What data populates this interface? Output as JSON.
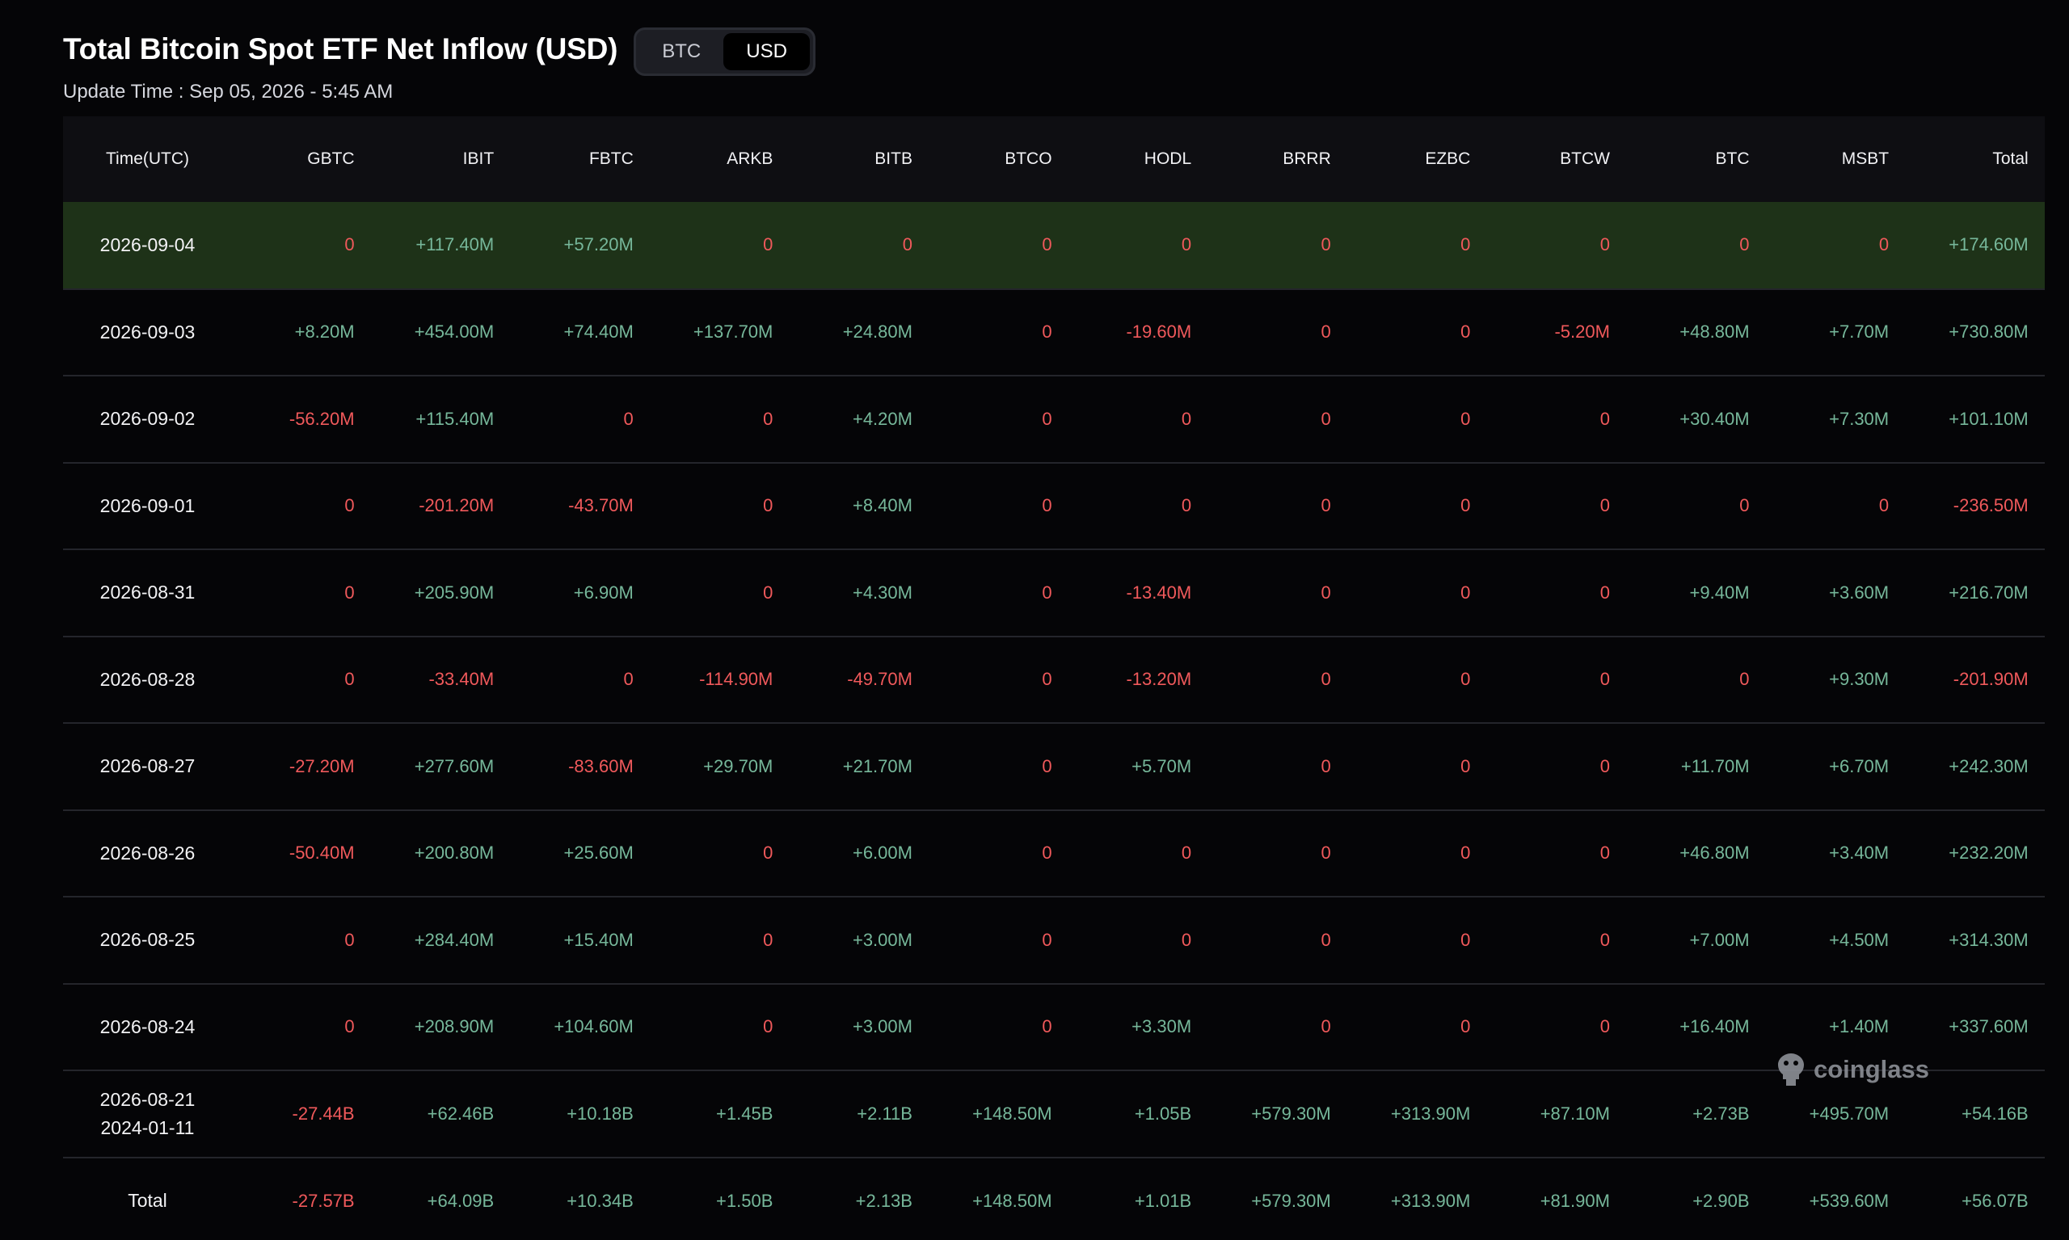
{
  "title": "Total Bitcoin Spot ETF Net Inflow (USD)",
  "toggle": {
    "btc_label": "BTC",
    "usd_label": "USD",
    "selected": "USD"
  },
  "update_time": "Update Time : Sep 05, 2026 - 5:45 AM",
  "watermark": "coinglass",
  "colors": {
    "positive": "#76b79a",
    "negative": "#f0595b",
    "highlight_row": "#1e3218"
  },
  "columns": [
    "Time(UTC)",
    "GBTC",
    "IBIT",
    "FBTC",
    "ARKB",
    "BITB",
    "BTCO",
    "HODL",
    "BRRR",
    "EZBC",
    "BTCW",
    "BTC",
    "MSBT",
    "Total"
  ],
  "rows": [
    {
      "time": [
        "2026-09-04"
      ],
      "highlight": true,
      "values": [
        "0",
        "+117.40M",
        "+57.20M",
        "0",
        "0",
        "0",
        "0",
        "0",
        "0",
        "0",
        "0",
        "0",
        "+174.60M"
      ]
    },
    {
      "time": [
        "2026-09-03"
      ],
      "values": [
        "+8.20M",
        "+454.00M",
        "+74.40M",
        "+137.70M",
        "+24.80M",
        "0",
        "-19.60M",
        "0",
        "0",
        "-5.20M",
        "+48.80M",
        "+7.70M",
        "+730.80M"
      ]
    },
    {
      "time": [
        "2026-09-02"
      ],
      "values": [
        "-56.20M",
        "+115.40M",
        "0",
        "0",
        "+4.20M",
        "0",
        "0",
        "0",
        "0",
        "0",
        "+30.40M",
        "+7.30M",
        "+101.10M"
      ]
    },
    {
      "time": [
        "2026-09-01"
      ],
      "values": [
        "0",
        "-201.20M",
        "-43.70M",
        "0",
        "+8.40M",
        "0",
        "0",
        "0",
        "0",
        "0",
        "0",
        "0",
        "-236.50M"
      ]
    },
    {
      "time": [
        "2026-08-31"
      ],
      "values": [
        "0",
        "+205.90M",
        "+6.90M",
        "0",
        "+4.30M",
        "0",
        "-13.40M",
        "0",
        "0",
        "0",
        "+9.40M",
        "+3.60M",
        "+216.70M"
      ]
    },
    {
      "time": [
        "2026-08-28"
      ],
      "values": [
        "0",
        "-33.40M",
        "0",
        "-114.90M",
        "-49.70M",
        "0",
        "-13.20M",
        "0",
        "0",
        "0",
        "0",
        "+9.30M",
        "-201.90M"
      ]
    },
    {
      "time": [
        "2026-08-27"
      ],
      "values": [
        "-27.20M",
        "+277.60M",
        "-83.60M",
        "+29.70M",
        "+21.70M",
        "0",
        "+5.70M",
        "0",
        "0",
        "0",
        "+11.70M",
        "+6.70M",
        "+242.30M"
      ]
    },
    {
      "time": [
        "2026-08-26"
      ],
      "values": [
        "-50.40M",
        "+200.80M",
        "+25.60M",
        "0",
        "+6.00M",
        "0",
        "0",
        "0",
        "0",
        "0",
        "+46.80M",
        "+3.40M",
        "+232.20M"
      ]
    },
    {
      "time": [
        "2026-08-25"
      ],
      "values": [
        "0",
        "+284.40M",
        "+15.40M",
        "0",
        "+3.00M",
        "0",
        "0",
        "0",
        "0",
        "0",
        "+7.00M",
        "+4.50M",
        "+314.30M"
      ]
    },
    {
      "time": [
        "2026-08-24"
      ],
      "values": [
        "0",
        "+208.90M",
        "+104.60M",
        "0",
        "+3.00M",
        "0",
        "+3.30M",
        "0",
        "0",
        "0",
        "+16.40M",
        "+1.40M",
        "+337.60M"
      ]
    },
    {
      "time": [
        "2026-08-21",
        "2024-01-11"
      ],
      "values": [
        "-27.44B",
        "+62.46B",
        "+10.18B",
        "+1.45B",
        "+2.11B",
        "+148.50M",
        "+1.05B",
        "+579.30M",
        "+313.90M",
        "+87.10M",
        "+2.73B",
        "+495.70M",
        "+54.16B"
      ]
    },
    {
      "time": [
        "Total"
      ],
      "total": true,
      "values": [
        "-27.57B",
        "+64.09B",
        "+10.34B",
        "+1.50B",
        "+2.13B",
        "+148.50M",
        "+1.01B",
        "+579.30M",
        "+313.90M",
        "+81.90M",
        "+2.90B",
        "+539.60M",
        "+56.07B"
      ]
    }
  ]
}
